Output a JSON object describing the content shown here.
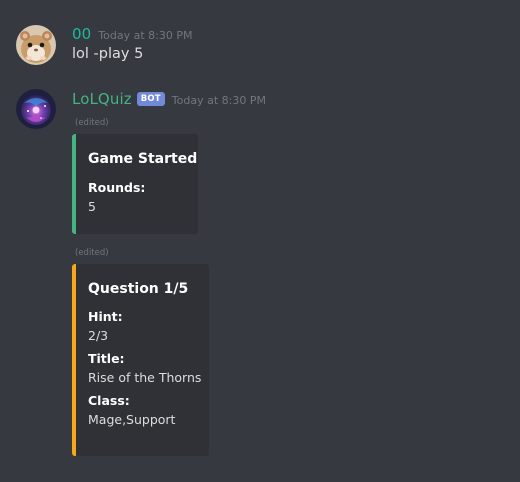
{
  "colors": {
    "background": "#36393f",
    "embed_background": "#2f3136",
    "user_name_color": "#1abc9c",
    "bot_name_color": "#43b581",
    "bot_tag_color": "#7289da",
    "embed1_bar": "#43b581",
    "embed2_bar": "#faa61a"
  },
  "messages": [
    {
      "author": "00",
      "timestamp": "Today at 8:30 PM",
      "text": "lol -play 5",
      "avatar_icon": "hamster-avatar"
    },
    {
      "author": "LoLQuiz",
      "bot_tag": "BOT",
      "timestamp": "Today at 8:30 PM",
      "avatar_icon": "galaxy-avatar",
      "embeds": [
        {
          "edited_label": "(edited)",
          "title": "Game Started",
          "fields": [
            {
              "name": "Rounds:",
              "value": "5"
            }
          ]
        },
        {
          "edited_label": "(edited)",
          "title": "Question 1/5",
          "fields": [
            {
              "name": "Hint:",
              "value": "2/3"
            },
            {
              "name": "Title:",
              "value": "Rise of the Thorns"
            },
            {
              "name": "Class:",
              "value": "Mage,Support"
            }
          ]
        }
      ]
    }
  ]
}
